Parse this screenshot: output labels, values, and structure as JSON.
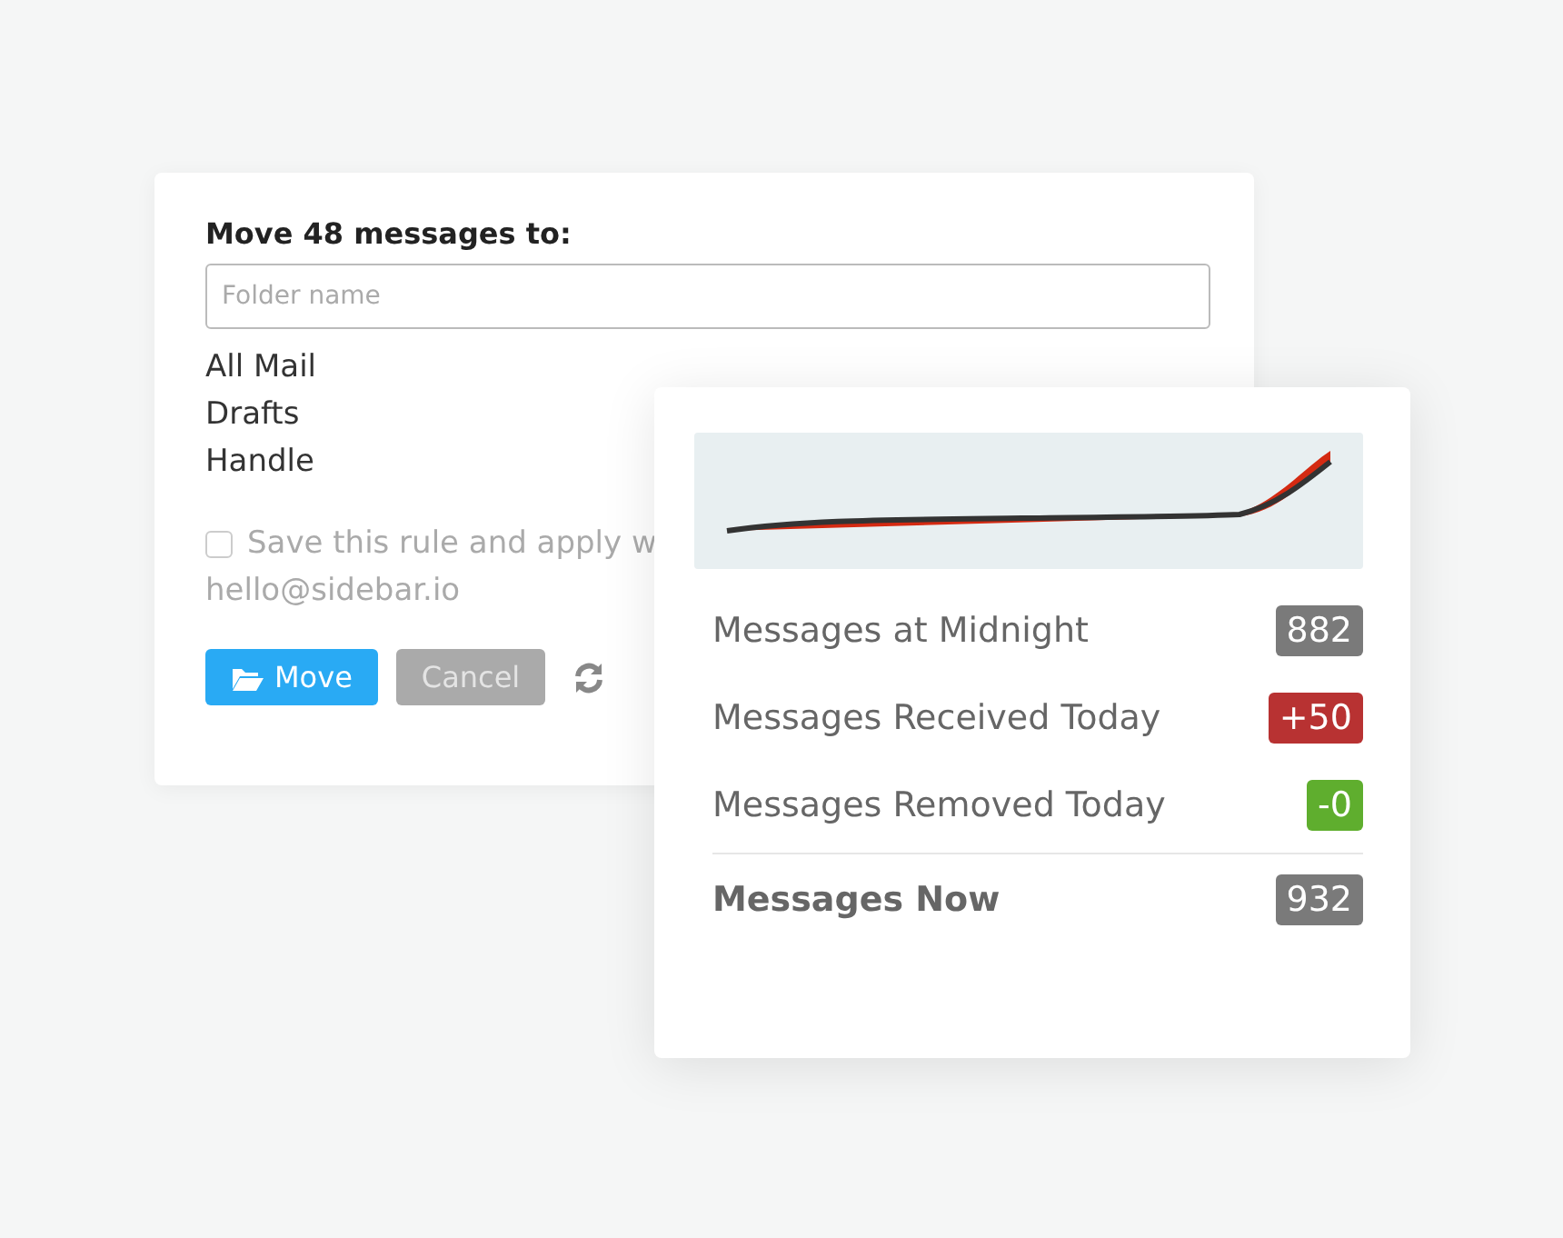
{
  "move_dialog": {
    "title": "Move 48 messages to:",
    "search": {
      "placeholder": "Folder name"
    },
    "folders": [
      "All Mail",
      "Drafts",
      "Handle"
    ],
    "save_rule": {
      "label": "Save this rule and apply w",
      "checked": false
    },
    "account": "hello@sidebar.io",
    "buttons": [
      {
        "kind": "primary",
        "label": "Move"
      },
      {
        "kind": "disabled",
        "label": "Cancel"
      }
    ]
  },
  "stats_card": {
    "stats": [
      {
        "kind": "normal",
        "label": "Messages at Midnight",
        "value": "882",
        "color": "#7a7a7a"
      },
      {
        "kind": "normal",
        "label": "Messages Received Today",
        "value": "+50",
        "color": "#b83232"
      },
      {
        "kind": "normal",
        "label": "Messages Removed Today",
        "value": "-0",
        "color": "#5fae2e"
      },
      {
        "kind": "total",
        "label": "Messages Now",
        "value": "932",
        "color": "#7a7a7a"
      }
    ]
  }
}
